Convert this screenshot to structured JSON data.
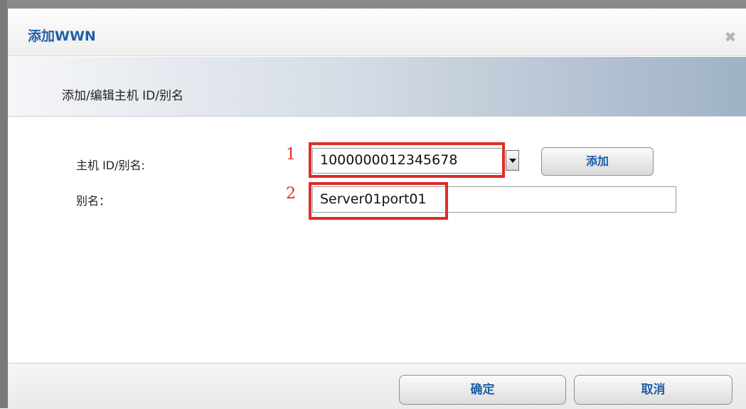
{
  "dialog": {
    "title": "添加WWN",
    "close_symbol": "✖",
    "subheader": "添加/编辑主机 ID/别名"
  },
  "form": {
    "host_id_label": "主机 ID/别名:",
    "host_id_value": "1000000012345678",
    "add_label": "添加",
    "alias_label": "别名：",
    "alias_value": "Server01port01"
  },
  "annotations": {
    "marker_1": "1",
    "marker_2": "2"
  },
  "footer": {
    "ok_label": "确定",
    "cancel_label": "取消"
  },
  "colors": {
    "title_blue": "#1f5fa6",
    "annotation_red": "#e02b2b"
  }
}
